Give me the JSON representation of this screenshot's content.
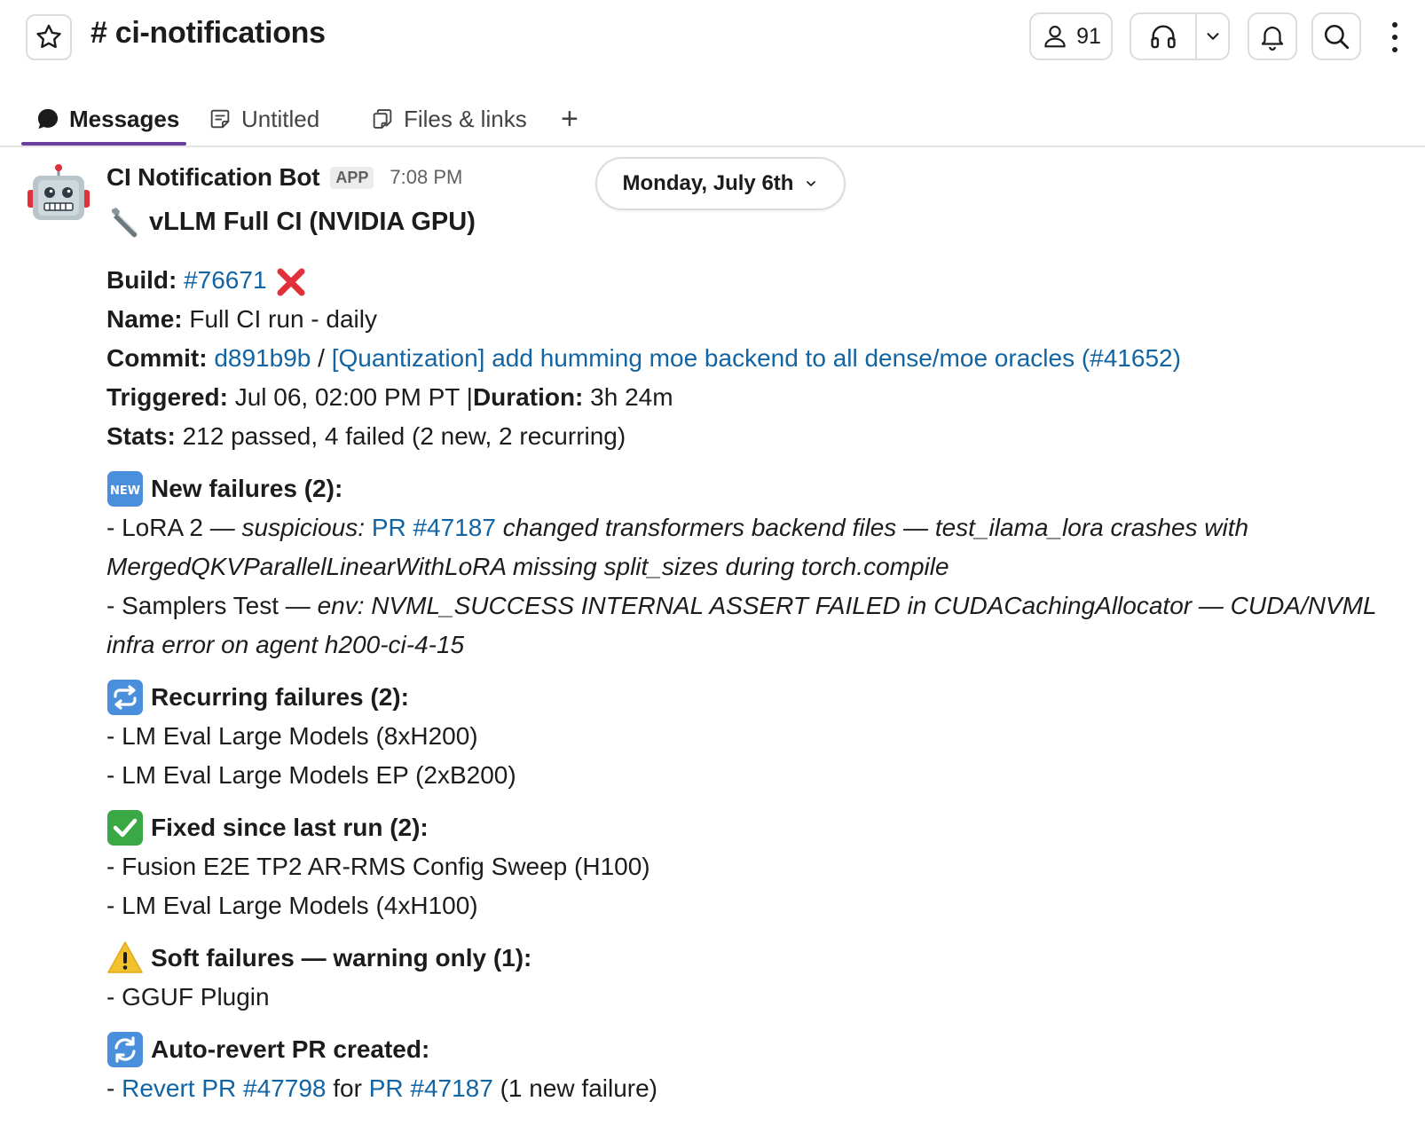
{
  "header": {
    "channel_name": "# ci-notifications",
    "member_count": "91",
    "icons": [
      "star-icon",
      "person-icon",
      "headphones-icon",
      "chevron-down-icon",
      "bell-icon",
      "search-icon",
      "more-vertical-icon"
    ]
  },
  "tabs": [
    {
      "label": "Messages",
      "icon": "message-bubble-icon",
      "active": true
    },
    {
      "label": "Untitled",
      "icon": "canvas-icon",
      "active": false
    },
    {
      "label": "Files & links",
      "icon": "files-icon",
      "active": false
    },
    {
      "label": "+",
      "icon": "plus-icon",
      "active": false
    }
  ],
  "date_divider": "Monday, July 6th",
  "message": {
    "sender": "CI Notification Bot",
    "badge": "APP",
    "time": "7:08 PM",
    "title": "vLLM Full CI (NVIDIA GPU)",
    "build_label": "Build:",
    "build_link": "#76671",
    "name_label": "Name:",
    "name_value": "Full CI run - daily",
    "commit_label": "Commit:",
    "commit_hash": "d891b9b",
    "commit_sep": "/",
    "commit_title": "[Quantization] add humming moe backend to all dense/moe oracles (#41652)",
    "triggered_label": "Triggered:",
    "triggered_value": "Jul 06, 02:00 PM PT",
    "pipe": "|",
    "duration_label": "Duration:",
    "duration_value": "3h 24m",
    "stats_label": "Stats:",
    "stats_value": "212 passed, 4 failed (2 new, 2 recurring)",
    "new_failures": {
      "heading": "New failures (2):",
      "badge_text": "NEW",
      "item1": {
        "prefix": "- LoRA 2 — ",
        "italic_a": "suspicious: ",
        "link": "PR #47187",
        "italic_b": " changed transformers backend files — test_ilama_lora crashes with MergedQKVParallelLinearWithLoRA missing split_sizes during torch.compile"
      },
      "item2": {
        "prefix": "- Samplers Test — ",
        "italic": "env: NVML_SUCCESS INTERNAL ASSERT FAILED in CUDACachingAllocator — CUDA/NVML infra error on agent h200-ci-4-15"
      }
    },
    "recurring_failures": {
      "heading": "Recurring failures (2):",
      "items": [
        "- LM Eval Large Models (8xH200)",
        "- LM Eval Large Models EP (2xB200)"
      ]
    },
    "fixed": {
      "heading": "Fixed since last run (2):",
      "items": [
        "- Fusion E2E TP2 AR-RMS Config Sweep (H100)",
        "- LM Eval Large Models (4xH100)"
      ]
    },
    "soft_failures": {
      "heading": "Soft failures — warning only (1):",
      "items": [
        "- GGUF Plugin"
      ]
    },
    "auto_revert": {
      "heading": "Auto-revert PR created:",
      "prefix": "- ",
      "link1": "Revert PR #47798",
      "mid": " for ",
      "link2": "PR #47187",
      "suffix": " (1 new failure)"
    }
  },
  "colors": {
    "link": "#1264a3",
    "tab_active_underline": "#6b3fa0",
    "fail_red": "#e0303a",
    "check_green": "#3aa845",
    "warning_yellow": "#f2c12e",
    "emoji_blue": "#4a8fdc"
  }
}
